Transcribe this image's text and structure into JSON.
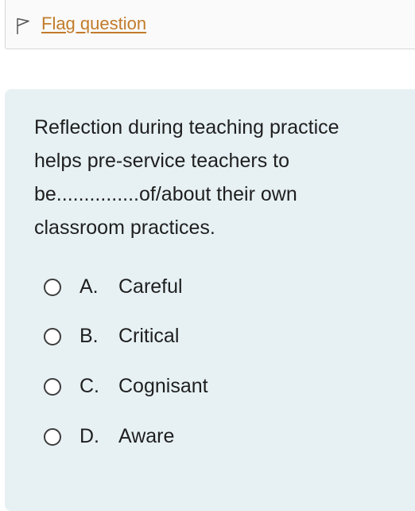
{
  "flag": {
    "icon": "flag-outline-icon",
    "label": "Flag question",
    "color": "#c27b2b"
  },
  "question": {
    "text": "Reflection during teaching practice\nhelps pre-service teachers to\nbe...............of/about their own\nclassroom practices.",
    "background": "#e7f1f4"
  },
  "options": [
    {
      "letter": "A.",
      "label": "Careful",
      "selected": false
    },
    {
      "letter": "B.",
      "label": "Critical",
      "selected": false
    },
    {
      "letter": "C.",
      "label": "Cognisant",
      "selected": false
    },
    {
      "letter": "D.",
      "label": "Aware",
      "selected": false
    }
  ]
}
